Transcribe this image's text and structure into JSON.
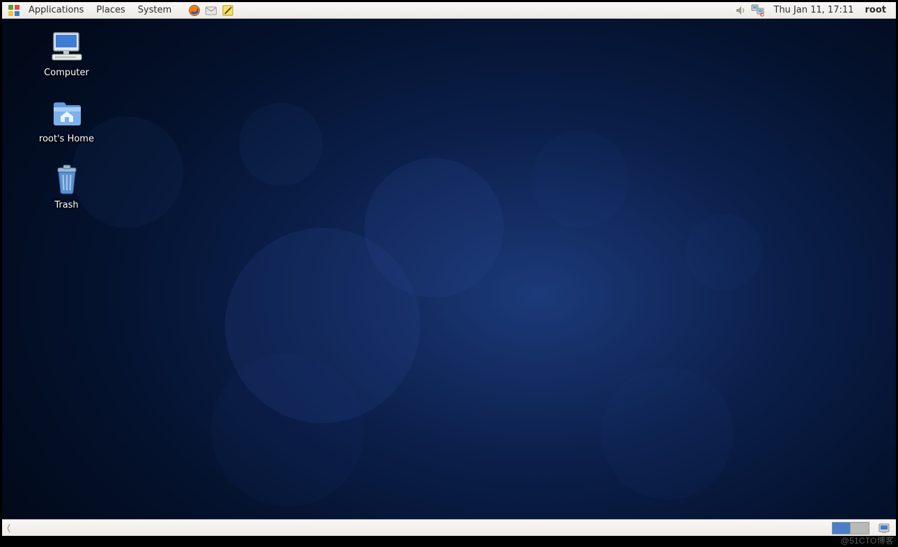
{
  "top_panel": {
    "menus": {
      "applications": "Applications",
      "places": "Places",
      "system": "System"
    },
    "launchers": {
      "firefox": "firefox-icon",
      "evolution": "evolution-mail-icon",
      "gedit": "text-editor-icon"
    },
    "tray": {
      "volume": "volume-icon",
      "network": "network-disconnected-icon"
    },
    "clock": "Thu Jan 11, 17:11",
    "user": "root"
  },
  "desktop": {
    "icons": [
      {
        "key": "computer",
        "label": "Computer"
      },
      {
        "key": "home",
        "label": "root's Home"
      },
      {
        "key": "trash",
        "label": "Trash"
      }
    ]
  },
  "bottom_panel": {
    "workspaces": {
      "count": 2,
      "active_index": 0
    },
    "show_desktop": "show-desktop-icon",
    "tray_drawer": "tray-drawer-icon"
  },
  "watermark": "@51CTO博客"
}
